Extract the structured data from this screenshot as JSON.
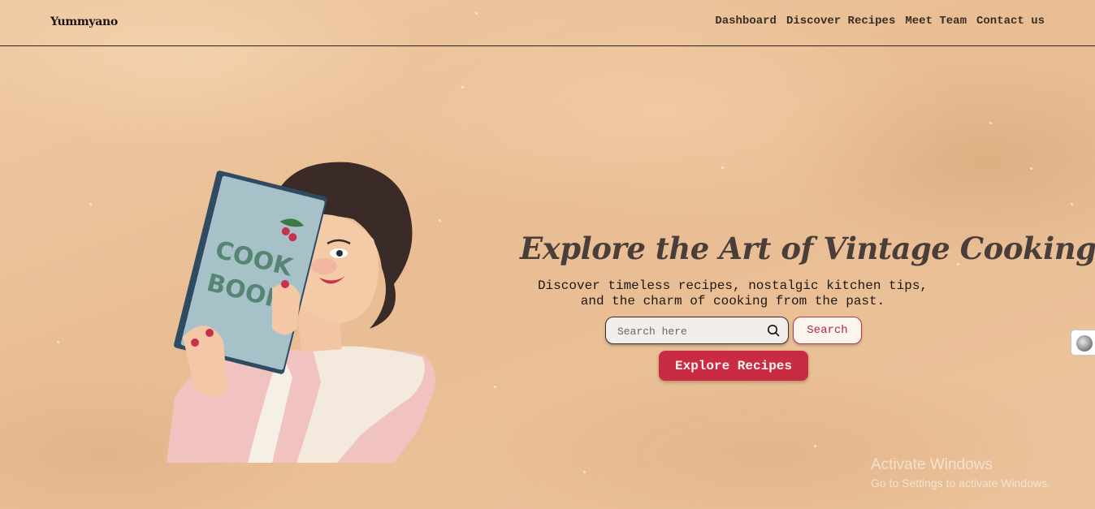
{
  "header": {
    "logo": "Yummyano",
    "nav": [
      "Dashboard",
      "Discover Recipes",
      "Meet Team",
      "Contact us"
    ]
  },
  "hero": {
    "title": "Explore the Art of Vintage Cooking",
    "subtitle": "Discover timeless recipes, nostalgic kitchen tips, and the charm of cooking from the past.",
    "search_placeholder": "Search here",
    "search_button": "Search",
    "explore_button": "Explore Recipes",
    "illustration_book_text": "COOK BOOK"
  },
  "watermark": {
    "title": "Activate Windows",
    "subtitle": "Go to Settings to activate Windows."
  },
  "colors": {
    "background": "#ecc49d",
    "accent": "#c92b43",
    "text_dark": "#1e1712"
  }
}
